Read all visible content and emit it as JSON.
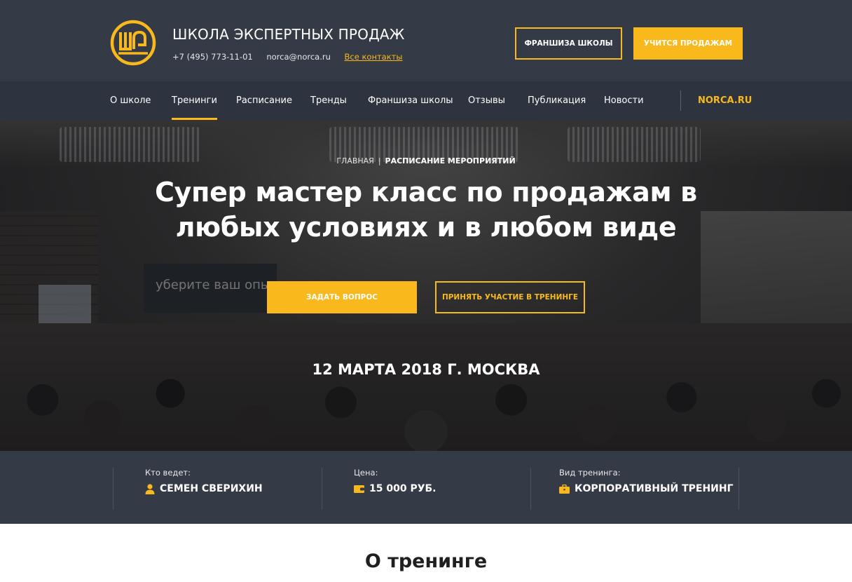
{
  "header": {
    "title": "ШКОЛА ЭКСПЕРТНЫХ ПРОДАЖ",
    "phone": "+7 (495) 773-11-01",
    "email": "norca@norca.ru",
    "contacts_link": "Все контакты",
    "btn_franchise": "ФРАНШИЗА ШКОЛЫ",
    "btn_learn": "УЧИТСЯ ПРОДАЖАМ",
    "logo_text": "ШЭП"
  },
  "nav": {
    "items": [
      "О школе",
      "Тренинги",
      "Расписание",
      "Тренды",
      "Франшиза школы",
      "Отзывы",
      "Публикация",
      "Новости"
    ],
    "active": "Тренинги",
    "site_link": "NORCA.RU"
  },
  "hero": {
    "breadcrumb": [
      "ГЛАВНАЯ",
      "РАСПИСАНИЕ МЕРОПРИЯТИЙ"
    ],
    "title": "Супер мастер класс по продажам в любых условиях и в любом виде",
    "btn_ask": "ЗАДАТЬ ВОПРОС",
    "btn_join": "ПРИНЯТЬ УЧАСТИЕ В ТРЕНИНГЕ",
    "date": "12 МАРТА 2018 Г. МОСКВА",
    "photo_screen_text": "уберите ваш опыт"
  },
  "info": {
    "host_label": "Кто ведет:",
    "host_value": "СЕМЕН СВЕРИХИН",
    "price_label": "Цена:",
    "price_value": "15 000 РУБ.",
    "type_label": "Вид тренинга:",
    "type_value": "КОРПОРАТИВНЫЙ ТРЕНИНГ"
  },
  "about": {
    "title": "О тренинге"
  },
  "colors": {
    "accent": "#f9b81b",
    "header_bg": "#343a46",
    "nav_bg": "#2d333f"
  }
}
